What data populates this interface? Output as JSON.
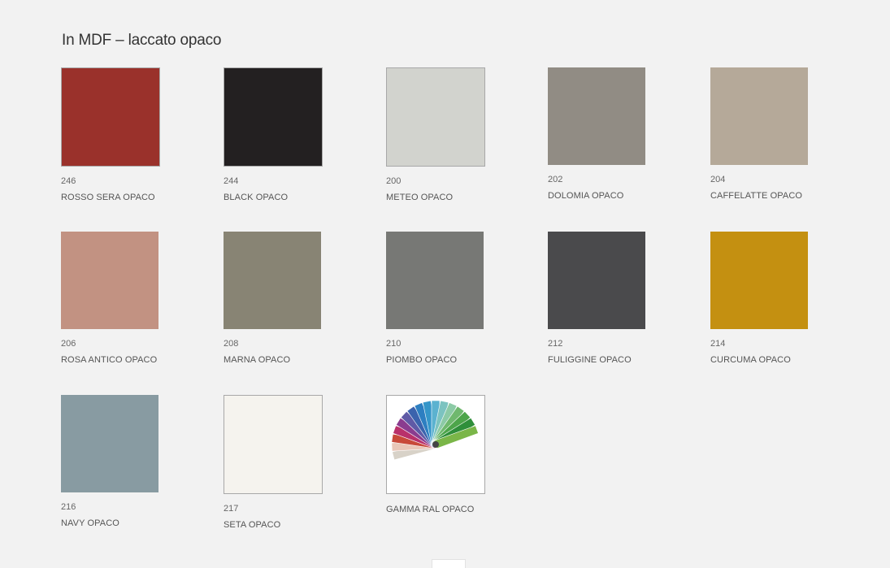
{
  "section": {
    "title": "In MDF – laccato opaco"
  },
  "swatches": [
    {
      "code": "246",
      "name": "ROSSO SERA OPACO",
      "color": "#9a312b",
      "border": true
    },
    {
      "code": "244",
      "name": "BLACK OPACO",
      "color": "#232021",
      "border": true
    },
    {
      "code": "200",
      "name": "METEO OPACO",
      "color": "#d2d3ce",
      "border": true
    },
    {
      "code": "202",
      "name": "DOLOMIA OPACO",
      "color": "#918c84",
      "border": false
    },
    {
      "code": "204",
      "name": "CAFFELATTE OPACO",
      "color": "#b5a999",
      "border": false
    },
    {
      "code": "206",
      "name": "ROSA ANTICO OPACO",
      "color": "#c29282",
      "border": false
    },
    {
      "code": "208",
      "name": "MARNA OPACO",
      "color": "#888474",
      "border": false
    },
    {
      "code": "210",
      "name": "PIOMBO OPACO",
      "color": "#777875",
      "border": false
    },
    {
      "code": "212",
      "name": "FULIGGINE OPACO",
      "color": "#4a4a4c",
      "border": false
    },
    {
      "code": "214",
      "name": "CURCUMA OPACO",
      "color": "#c49011",
      "border": false
    },
    {
      "code": "216",
      "name": "NAVY OPACO",
      "color": "#889ba2",
      "border": false
    },
    {
      "code": "217",
      "name": "SETA OPACO",
      "color": "#f5f3ee",
      "border": true
    },
    {
      "code": "",
      "name": "GAMMA RAL OPACO",
      "color": "#ffffff",
      "border": true,
      "icon": "ral-color-fan-icon"
    }
  ]
}
